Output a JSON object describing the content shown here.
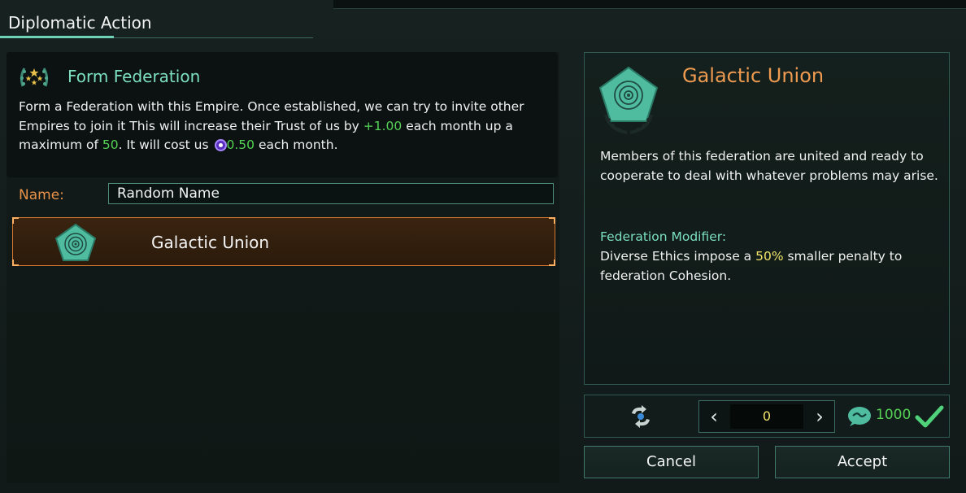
{
  "window": {
    "title": "Diplomatic Action"
  },
  "action": {
    "icon": "federation-stars-icon",
    "title": "Form Federation",
    "desc_1": "Form a Federation with this Empire. Once established, we can try to invite other Empires to join it This will increase their Trust of us by ",
    "trust_gain": "+1.00",
    "desc_2": " each month up a maximum of ",
    "trust_max": "50",
    "desc_3": ". It will cost us ",
    "cost": "0.50",
    "desc_4": " each month."
  },
  "name_field": {
    "label": "Name:",
    "value": "Random Name"
  },
  "federation_list": [
    {
      "name": "Galactic Union",
      "selected": true
    }
  ],
  "details": {
    "title": "Galactic Union",
    "description": "Members of this federation are united and ready to cooperate to deal with whatever problems may arise.",
    "modifier_label": "Federation Modifier:",
    "modifier_1": "Diverse Ethics impose a ",
    "modifier_value": "50%",
    "modifier_2": " smaller penalty to federation Cohesion."
  },
  "bottom_bar": {
    "stepper_value": "0",
    "cost_value": "1000"
  },
  "buttons": {
    "cancel": "Cancel",
    "accept": "Accept"
  },
  "colors": {
    "accent_teal": "#7ce0c0",
    "accent_orange": "#ee9a50",
    "positive_green": "#55d255",
    "highlight_yellow": "#f2e46a"
  }
}
